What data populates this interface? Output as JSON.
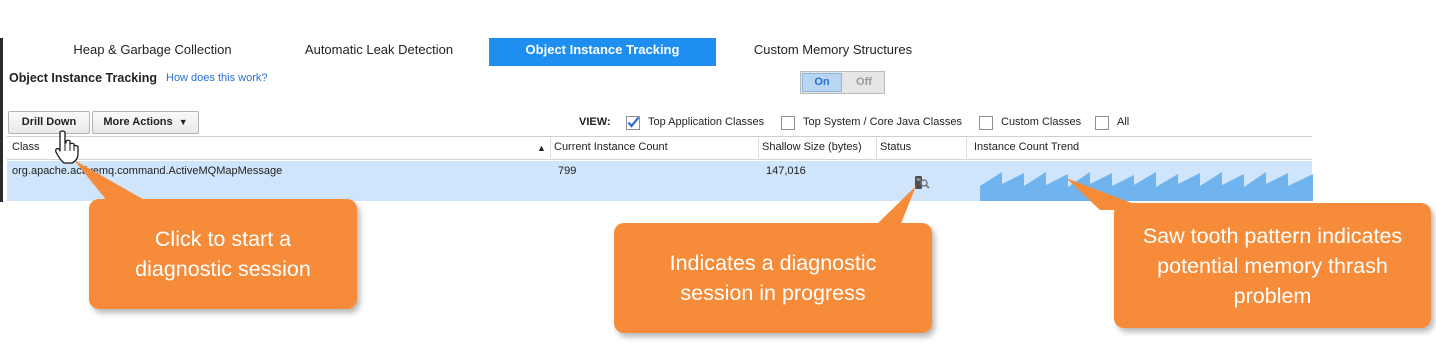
{
  "tabs": [
    {
      "label": "Heap & Garbage Collection",
      "active": false
    },
    {
      "label": "Automatic Leak Detection",
      "active": false
    },
    {
      "label": "Object Instance Tracking",
      "active": true
    },
    {
      "label": "Custom Memory Structures",
      "active": false
    }
  ],
  "section": {
    "title": "Object Instance Tracking",
    "help_link": "How does this work?"
  },
  "toggle": {
    "on_label": "On",
    "off_label": "Off",
    "state": "On"
  },
  "toolbar": {
    "drill_down_label": "Drill Down",
    "more_actions_label": "More Actions"
  },
  "view": {
    "label": "VIEW:",
    "options": [
      {
        "label": "Top Application Classes",
        "checked": true
      },
      {
        "label": "Top System / Core Java Classes",
        "checked": false
      },
      {
        "label": "Custom Classes",
        "checked": false
      },
      {
        "label": "All",
        "checked": false
      }
    ]
  },
  "table": {
    "columns": [
      "Class",
      "Current Instance Count",
      "Shallow Size (bytes)",
      "Status",
      "Instance Count Trend"
    ],
    "sort_indicator": "▲",
    "rows": [
      {
        "class": "org.apache.activemq.command.ActiveMQMapMessage",
        "count": "799",
        "size": "147,016",
        "status": "diagnostic-in-progress-icon"
      }
    ]
  },
  "callouts": {
    "drill_down": "Click to start a diagnostic session",
    "status": "Indicates a diagnostic session in progress",
    "trend": "Saw tooth pattern indicates potential memory thrash problem"
  },
  "colors": {
    "active_tab": "#1e8ff0",
    "callout": "#f68c3a",
    "row_selected": "#cfe5fb",
    "sparkline": "#6fb3ef"
  }
}
